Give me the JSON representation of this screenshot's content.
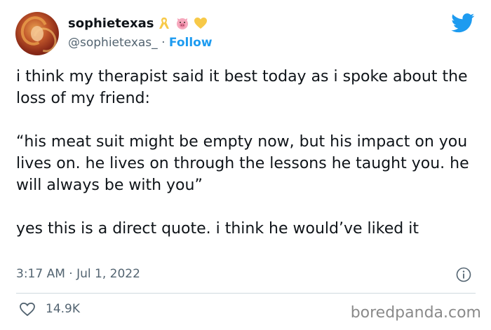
{
  "tweet": {
    "display_name": "sophietexas",
    "handle": "@sophietexas_",
    "separator": " · ",
    "follow_label": "Follow",
    "name_emojis": [
      "yellow-ribbon-icon",
      "pig-face-icon",
      "yellow-heart-icon"
    ],
    "paragraphs": [
      "i think my therapist said it best today as i spoke about the loss of my friend:",
      "“his meat suit might be empty now, but his impact on you lives on. he lives on through the lessons he taught you. he will always be with you”",
      "yes this is a direct quote. i think he would’ve liked it"
    ],
    "timestamp": "3:17 AM · Jul 1, 2022",
    "like_count": "14.9K"
  },
  "watermark": "boredpanda.com",
  "colors": {
    "accent": "#1d9bf0",
    "text": "#0f1419",
    "muted": "#536471",
    "divider": "#cfd9de"
  }
}
